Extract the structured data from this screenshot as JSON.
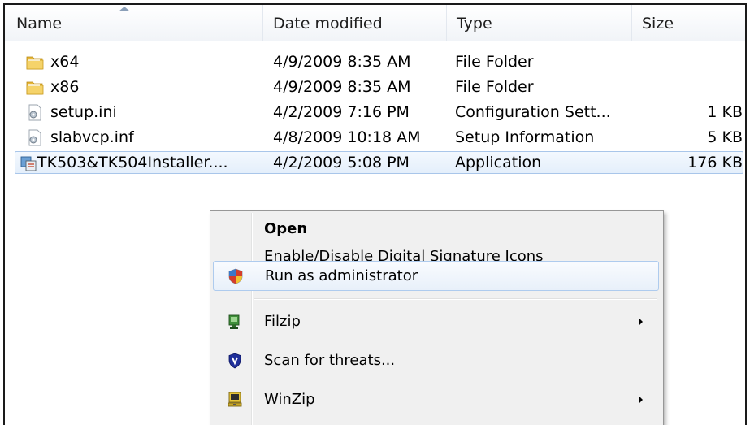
{
  "columns": {
    "name": "Name",
    "date": "Date modified",
    "type": "Type",
    "size": "Size"
  },
  "files": [
    {
      "name": "x64",
      "date": "4/9/2009 8:35 AM",
      "type": "File Folder",
      "size": "",
      "icon": "folder-icon"
    },
    {
      "name": "x86",
      "date": "4/9/2009 8:35 AM",
      "type": "File Folder",
      "size": "",
      "icon": "folder-icon"
    },
    {
      "name": "setup.ini",
      "date": "4/2/2009 7:16 PM",
      "type": "Configuration Sett...",
      "size": "1 KB",
      "icon": "config-file-icon"
    },
    {
      "name": "slabvcp.inf",
      "date": "4/8/2009 10:18 AM",
      "type": "Setup Information",
      "size": "5 KB",
      "icon": "config-file-icon"
    },
    {
      "name": "TK503&TK504Installer....",
      "date": "4/2/2009 5:08 PM",
      "type": "Application",
      "size": "176 KB",
      "icon": "installer-icon",
      "selected": true
    }
  ],
  "context_menu": {
    "open": "Open",
    "digital_signature": "Enable/Disable Digital Signature Icons",
    "run_as_admin": "Run as administrator",
    "filzip": "Filzip",
    "scan": "Scan for threats...",
    "winzip": "WinZip"
  },
  "colors": {
    "selection_border": "#a9c6ea",
    "menu_background": "#f0f0f0"
  }
}
